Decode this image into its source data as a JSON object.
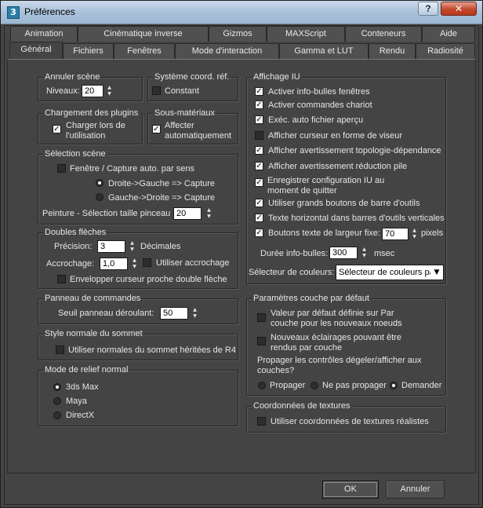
{
  "window": {
    "title": "Préférences",
    "help_label": "?",
    "close_label": "✕"
  },
  "tabs_row1": [
    "Animation",
    "Cinématique inverse",
    "Gizmos",
    "MAXScript",
    "Conteneurs",
    "Aide"
  ],
  "tabs_row2": [
    "Général",
    "Fichiers",
    "Fenêtres",
    "Mode d'interaction",
    "Gamma et LUT",
    "Rendu",
    "Radiosité"
  ],
  "active_tab": "Général",
  "annuler_scene": {
    "title": "Annuler scène",
    "levels_label": "Niveaux:",
    "levels_value": "20"
  },
  "coord_system": {
    "title": "Système coord. réf.",
    "constant_label": "Constant",
    "constant_checked": false
  },
  "plugin_loading": {
    "title": "Chargement des plugins",
    "load_on_use_label": "Charger lors de l'utilisation",
    "load_on_use_checked": true
  },
  "sub_materials": {
    "title": "Sous-matériaux",
    "auto_assign_label": "Affecter automatiquement",
    "auto_assign_checked": true
  },
  "scene_selection": {
    "title": "Sélection scène",
    "auto_window_label": "Fenêtre / Capture auto. par sens",
    "auto_window_checked": false,
    "right_left_label": "Droite->Gauche => Capture",
    "left_right_label": "Gauche->Droite => Capture",
    "selected_direction": "right_left",
    "paint_brush_label": "Peinture - Sélection taille pinceau",
    "paint_brush_value": "20"
  },
  "spinners": {
    "title": "Doubles flèches",
    "precision_label": "Précision:",
    "precision_value": "3",
    "decimals_label": "Décimales",
    "snap_label": "Accrochage:",
    "snap_value": "1,0",
    "use_snap_label": "Utiliser accrochage",
    "use_snap_checked": false,
    "wrap_cursor_label": "Envelopper curseur proche double flèche",
    "wrap_cursor_checked": false
  },
  "command_panel": {
    "title": "Panneau de commandes",
    "rollout_label": "Seuil panneau déroulant:",
    "rollout_value": "50"
  },
  "vertex_normal": {
    "title": "Style normale du sommet",
    "legacy_label": "Utiliser normales du sommet héritées de R4",
    "legacy_checked": false
  },
  "bump_mode": {
    "title": "Mode de relief normal",
    "options": [
      "3ds Max",
      "Maya",
      "DirectX"
    ],
    "selected": "3ds Max"
  },
  "ui_display": {
    "title": "Affichage IU",
    "items": [
      {
        "label": "Activer info-bulles fenêtres",
        "checked": true
      },
      {
        "label": "Activer commandes chariot",
        "checked": true
      },
      {
        "label": "Exéc. auto fichier aperçu",
        "checked": true
      },
      {
        "label": "Afficher curseur en forme de viseur",
        "checked": false
      },
      {
        "label": "Afficher avertissement topologie-dépendance",
        "checked": true
      },
      {
        "label": "Afficher avertissement réduction pile",
        "checked": true
      },
      {
        "label": "Enregistrer configuration IU au moment de quitter",
        "checked": true
      },
      {
        "label": "Utiliser grands boutons de barre d'outils",
        "checked": true
      },
      {
        "label": "Texte horizontal dans barres d'outils verticales",
        "checked": true
      }
    ],
    "fixed_width_label": "Boutons texte de largeur fixe:",
    "fixed_width_checked": true,
    "fixed_width_value": "70",
    "fixed_width_unit": "pixels",
    "tooltip_duration_label": "Durée info-bulles:",
    "tooltip_duration_value": "300",
    "tooltip_duration_unit": "msec",
    "color_selector_label": "Sélecteur de couleurs:",
    "color_selector_value": "Sélecteur de couleurs pa"
  },
  "layer_defaults": {
    "title": "Paramètres couche par défaut",
    "default_by_layer_label": "Valeur par défaut définie sur Par couche pour les nouveaux noeuds",
    "default_by_layer_checked": false,
    "new_lights_label": "Nouveaux éclairages pouvant être rendus par couche",
    "new_lights_checked": false,
    "propagate_question": "Propager les contrôles dégeler/afficher aux couches?",
    "propagate_options": [
      "Propager",
      "Ne pas propager",
      "Demander"
    ],
    "propagate_selected": "Demander"
  },
  "texture_coords": {
    "title": "Coordonnées de textures",
    "real_world_label": "Utiliser coordonnées de textures réalistes",
    "real_world_checked": false
  },
  "footer": {
    "ok_label": "OK",
    "cancel_label": "Annuler"
  },
  "colors": {
    "panel": "#444444",
    "title_bar": "#a7bfd8",
    "close_button": "#c34a2c"
  }
}
